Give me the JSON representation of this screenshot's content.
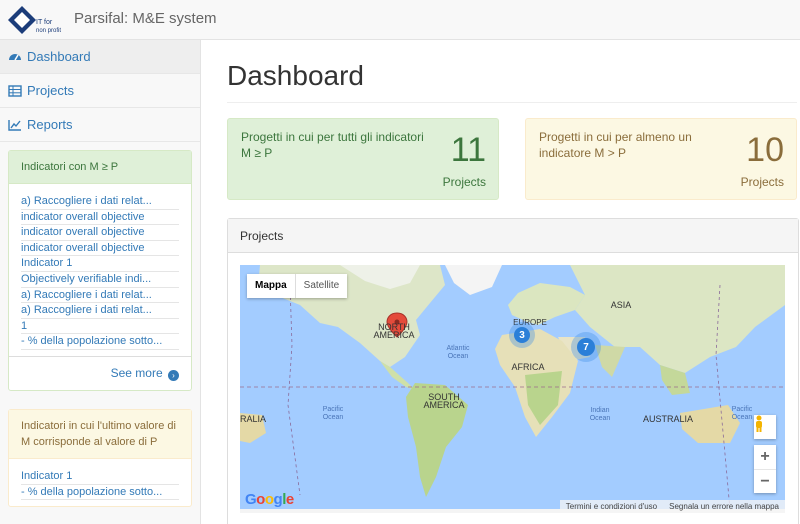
{
  "header": {
    "logo_text": "IT for non profit",
    "brand": "Parsifal: M&E system"
  },
  "sidebar": {
    "nav": [
      {
        "label": "Dashboard",
        "icon": "dashboard-icon",
        "active": true
      },
      {
        "label": "Projects",
        "icon": "table-icon",
        "active": false
      },
      {
        "label": "Reports",
        "icon": "line-chart-icon",
        "active": false
      }
    ],
    "panel1": {
      "title": "Indicatori con M ≥ P",
      "items": [
        "a) Raccogliere i dati relat...",
        "indicator overall objective",
        "indicator overall objective",
        "indicator overall objective",
        "Indicator 1",
        "Objectively verifiable indi...",
        "a) Raccogliere i dati relat...",
        "a) Raccogliere i dati relat...",
        "1",
        "- % della popolazione sotto..."
      ],
      "see_more": "See more"
    },
    "panel2": {
      "title": "Indicatori in cui l'ultimo valore di M corrisponde al valore di P",
      "items": [
        "Indicator 1",
        "- % della popolazione sotto..."
      ]
    }
  },
  "main": {
    "title": "Dashboard",
    "stats": [
      {
        "text": "Progetti in cui per tutti gli indicatori M ≥ P",
        "value": "11",
        "unit": "Projects",
        "color": "#dff0d8"
      },
      {
        "text": "Progetti in cui per almeno un indicatore M > P",
        "value": "10",
        "unit": "Projects",
        "color": "#fcf8e3"
      }
    ],
    "projects_panel": {
      "title": "Projects",
      "map": {
        "type_buttons": [
          "Mappa",
          "Satellite"
        ],
        "clusters": [
          {
            "label": "3",
            "region": "Europe"
          },
          {
            "label": "7",
            "region": "South Asia"
          }
        ],
        "marker": "North America",
        "labels": {
          "north_america": "NORTH AMERICA",
          "south_america": "SOUTH AMERICA",
          "europe": "EUROPE",
          "asia": "ASIA",
          "africa": "AFRICA",
          "australia_left": "RALIA",
          "australia": "AUSTRALIA",
          "atlantic": "Atlantic Ocean",
          "pacific": "Pacific Ocean",
          "indian": "Indian Ocean",
          "pacific_right": "Pacific Ocean"
        },
        "zoom_in": "+",
        "zoom_out": "−",
        "google": [
          "G",
          "o",
          "o",
          "g",
          "l",
          "e"
        ],
        "footer": [
          "Termini e condizioni d'uso",
          "Segnala un errore nella mappa"
        ]
      }
    }
  }
}
